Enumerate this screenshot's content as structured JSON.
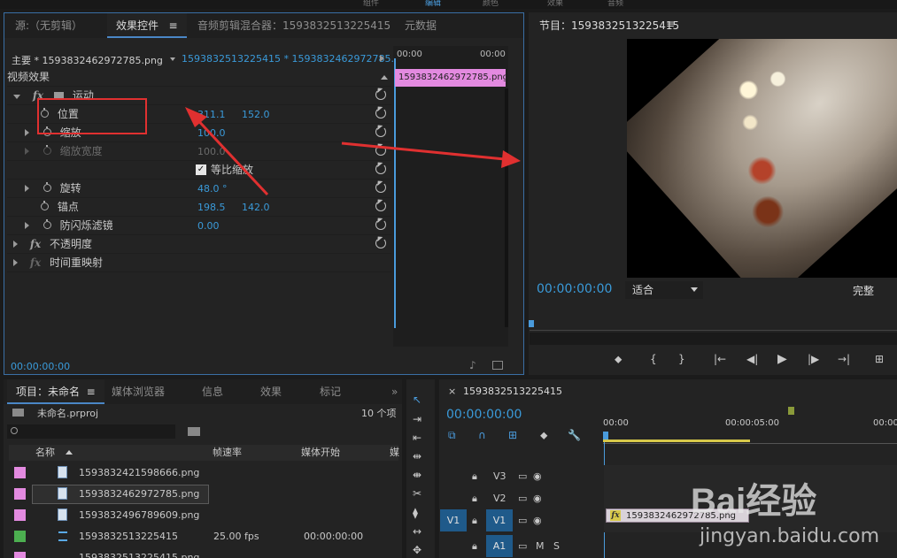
{
  "top_strip": {
    "items": [
      "组件",
      "编辑",
      "颜色",
      "效果",
      "音频"
    ]
  },
  "effect_tabs": [
    {
      "label": "源:（无剪辑）"
    },
    {
      "label": "效果控件",
      "menu": "≡"
    },
    {
      "label": "音频剪辑混合器：1593832513225415"
    },
    {
      "label": "元数据"
    }
  ],
  "effect_controls": {
    "source_label": "主要 * 1593832462972785.png",
    "sequence_label": "1593832513225415 * 1593832462972785.png",
    "section_title": "视频效果",
    "motion_label": "运动",
    "props": [
      {
        "name": "位置",
        "v1": "311.1",
        "v2": "152.0"
      },
      {
        "name": "缩放",
        "v1": "100.0",
        "v2": ""
      },
      {
        "name": "缩放宽度",
        "v1": "100.0",
        "v2": ""
      },
      {
        "name": "等比缩放",
        "v1": "",
        "v2": ""
      },
      {
        "name": "旋转",
        "v1": "48.0 °",
        "v2": ""
      },
      {
        "name": "锚点",
        "v1": "198.5",
        "v2": "142.0"
      },
      {
        "name": "防闪烁滤镜",
        "v1": "0.00",
        "v2": ""
      }
    ],
    "opacity_label": "不透明度",
    "remap_label": "时间重映射",
    "timecode": "00:00:00:00",
    "mini_timeline": {
      "t0": "00:00",
      "t1": "00:00",
      "clip": "1593832462972785.png"
    }
  },
  "program": {
    "title": "节目：1593832513225415",
    "menu": "≡",
    "timecode": "00:00:00:00",
    "fit": "适合",
    "quality": "完整"
  },
  "project_tabs": [
    {
      "label": "项目：未命名",
      "menu": "≡"
    },
    {
      "label": "媒体浏览器"
    },
    {
      "label": "信息"
    },
    {
      "label": "效果"
    },
    {
      "label": "标记"
    }
  ],
  "project": {
    "file": "未命名.prproj",
    "count": "10 个项",
    "columns": [
      "名称",
      "帧速率",
      "媒体开始",
      "媒"
    ],
    "items": [
      {
        "name": "1593832421598666.png",
        "fps": "",
        "start": "",
        "color": "#e38ae0"
      },
      {
        "name": "1593832462972785.png",
        "fps": "",
        "start": "",
        "color": "#e38ae0"
      },
      {
        "name": "1593832496789609.png",
        "fps": "",
        "start": "",
        "color": "#e38ae0"
      },
      {
        "name": "1593832513225415",
        "fps": "25.00 fps",
        "start": "00:00:00:00",
        "color": "#4caf50"
      },
      {
        "name": "1593832513225415.png",
        "fps": "",
        "start": "",
        "color": "#e38ae0"
      }
    ]
  },
  "timeline": {
    "tab": "1593832513225415",
    "timecode": "00:00:00:00",
    "ruler": [
      "00:00",
      "00:00:05:00",
      "00:00"
    ],
    "tracks": [
      {
        "id": "V3",
        "src": ""
      },
      {
        "id": "V2",
        "src": ""
      },
      {
        "id": "V1",
        "src": "V1"
      },
      {
        "id": "A1",
        "src": ""
      }
    ],
    "clip": "1593832462972785.png"
  },
  "watermark": {
    "brand": "Bai经验",
    "url": "jingyan.baidu.com"
  },
  "colors": {
    "accent": "#3a9ad9",
    "annotation": "#e03030",
    "clip_pink": "#e38ae0"
  }
}
